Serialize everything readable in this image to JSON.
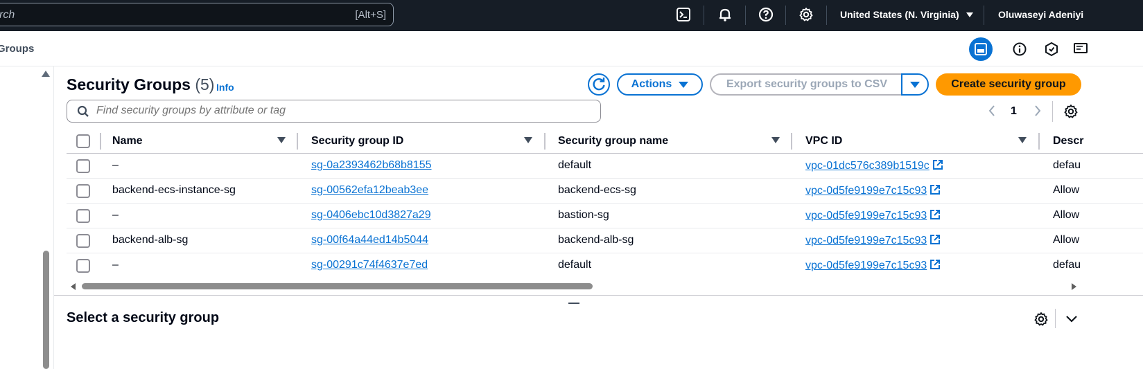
{
  "topnav": {
    "search_placeholder": "rch",
    "search_shortcut": "[Alt+S]",
    "region": "United States (N. Virginia)",
    "user": "Oluwaseyi Adeniyi"
  },
  "breadcrumb": {
    "current": "Groups"
  },
  "panel": {
    "title": "Security Groups",
    "count": "(5)",
    "info": "Info",
    "actions_label": "Actions",
    "export_label": "Export security groups to CSV",
    "create_label": "Create security group",
    "filter_placeholder": "Find security groups by attribute or tag",
    "page": "1"
  },
  "table": {
    "columns": [
      "Name",
      "Security group ID",
      "Security group name",
      "VPC ID",
      "Descr"
    ],
    "rows": [
      {
        "name": "–",
        "id": "sg-0a2393462b68b8155",
        "group_name": "default",
        "vpc": "vpc-01dc576c389b1519c",
        "desc": "defau"
      },
      {
        "name": "backend-ecs-instance-sg",
        "id": "sg-00562efa12beab3ee",
        "group_name": "backend-ecs-sg",
        "vpc": "vpc-0d5fe9199e7c15c93",
        "desc": "Allow"
      },
      {
        "name": "–",
        "id": "sg-0406ebc10d3827a29",
        "group_name": "bastion-sg",
        "vpc": "vpc-0d5fe9199e7c15c93",
        "desc": "Allow"
      },
      {
        "name": "backend-alb-sg",
        "id": "sg-00f64a44ed14b5044",
        "group_name": "backend-alb-sg",
        "vpc": "vpc-0d5fe9199e7c15c93",
        "desc": "Allow"
      },
      {
        "name": "–",
        "id": "sg-00291c74f4637e7ed",
        "group_name": "default",
        "vpc": "vpc-0d5fe9199e7c15c93",
        "desc": "defau"
      }
    ]
  },
  "detail": {
    "title": "Select a security group"
  },
  "colors": {
    "nav_bg": "#161d26",
    "link": "#0972d3",
    "primary": "#ff9900"
  },
  "icons": [
    "cloudshell-icon",
    "bell-icon",
    "help-icon",
    "gear-icon",
    "caret-down-icon",
    "split-panel-icon",
    "info-icon",
    "status-icon",
    "feedback-icon",
    "refresh-icon",
    "search-icon",
    "external-link-icon",
    "chevron-left-icon",
    "chevron-right-icon",
    "chevron-down-icon"
  ]
}
